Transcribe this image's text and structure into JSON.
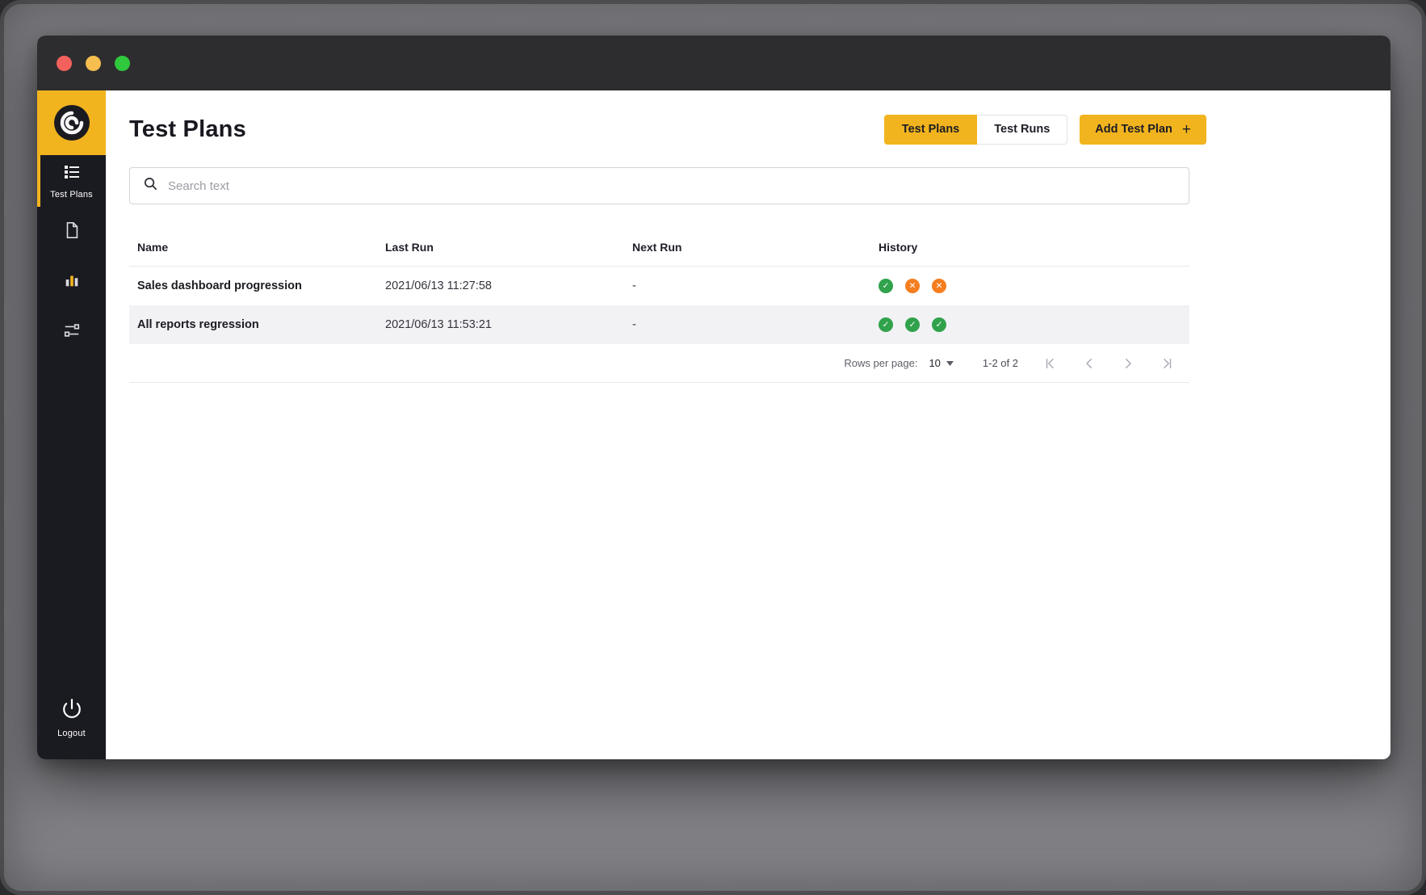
{
  "colors": {
    "accent": "#F2B41E",
    "pass": "#31A24C",
    "fail": "#F57E20"
  },
  "sidebar": {
    "items": [
      {
        "label": "Test Plans",
        "icon": "test-plans-icon",
        "active": true
      },
      {
        "icon": "document-icon",
        "active": false
      },
      {
        "icon": "bar-chart-icon",
        "active": false
      },
      {
        "icon": "workflow-icon",
        "active": false
      }
    ],
    "logout_label": "Logout"
  },
  "header": {
    "title": "Test Plans",
    "tabs": [
      {
        "label": "Test Plans",
        "active": true
      },
      {
        "label": "Test Runs",
        "active": false
      }
    ],
    "add_button": {
      "label": "Add Test Plan",
      "icon": "+"
    }
  },
  "search": {
    "placeholder": "Search text"
  },
  "table": {
    "columns": [
      "Name",
      "Last Run",
      "Next Run",
      "History"
    ],
    "rows": [
      {
        "name": "Sales dashboard progression",
        "last_run": "2021/06/13 11:27:58",
        "next_run": "-",
        "history": [
          "pass",
          "fail",
          "fail"
        ]
      },
      {
        "name": "All reports regression",
        "last_run": "2021/06/13 11:53:21",
        "next_run": "-",
        "history": [
          "pass",
          "pass",
          "pass"
        ]
      }
    ]
  },
  "pagination": {
    "rows_per_page_label": "Rows per page:",
    "rows_per_page_value": "10",
    "range_label": "1-2 of 2"
  }
}
